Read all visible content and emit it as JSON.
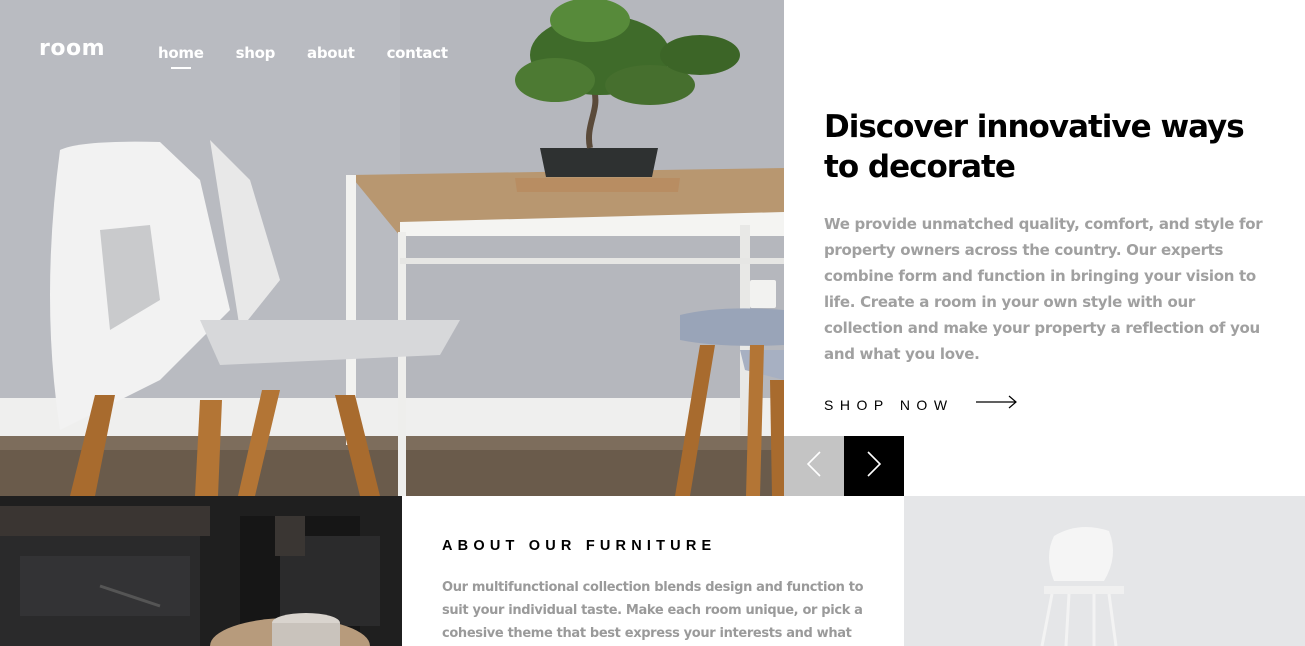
{
  "header": {
    "logo": "room",
    "nav": [
      {
        "label": "home",
        "active": true
      },
      {
        "label": "shop",
        "active": false
      },
      {
        "label": "about",
        "active": false
      },
      {
        "label": "contact",
        "active": false
      }
    ]
  },
  "hero": {
    "title": "Discover innovative ways to decorate",
    "description": "We provide unmatched quality, comfort, and style for property owners across the country. Our experts combine form and function in bringing your vision to life. Create a room in your own style with our collection and make your property a reflection of you and what you love.",
    "cta_label": "SHOP NOW",
    "cta_icon": "arrow-right-icon",
    "image": "dining-chairs-table-bonsai"
  },
  "slider": {
    "prev_icon": "chevron-left-icon",
    "next_icon": "chevron-right-icon"
  },
  "about": {
    "title": "ABOUT OUR FURNITURE",
    "description": "Our multifunctional collection blends design and function to suit your individual taste. Make each room unique, or pick a cohesive theme that best express your interests and what inspires you. Find the furniture",
    "image_left": "dark-living-room",
    "image_right": "white-chair"
  },
  "colors": {
    "text_dark": "#000000",
    "text_muted": "#a0a0a0",
    "slider_prev_bg": "#c4c4c4",
    "slider_next_bg": "#000000"
  }
}
